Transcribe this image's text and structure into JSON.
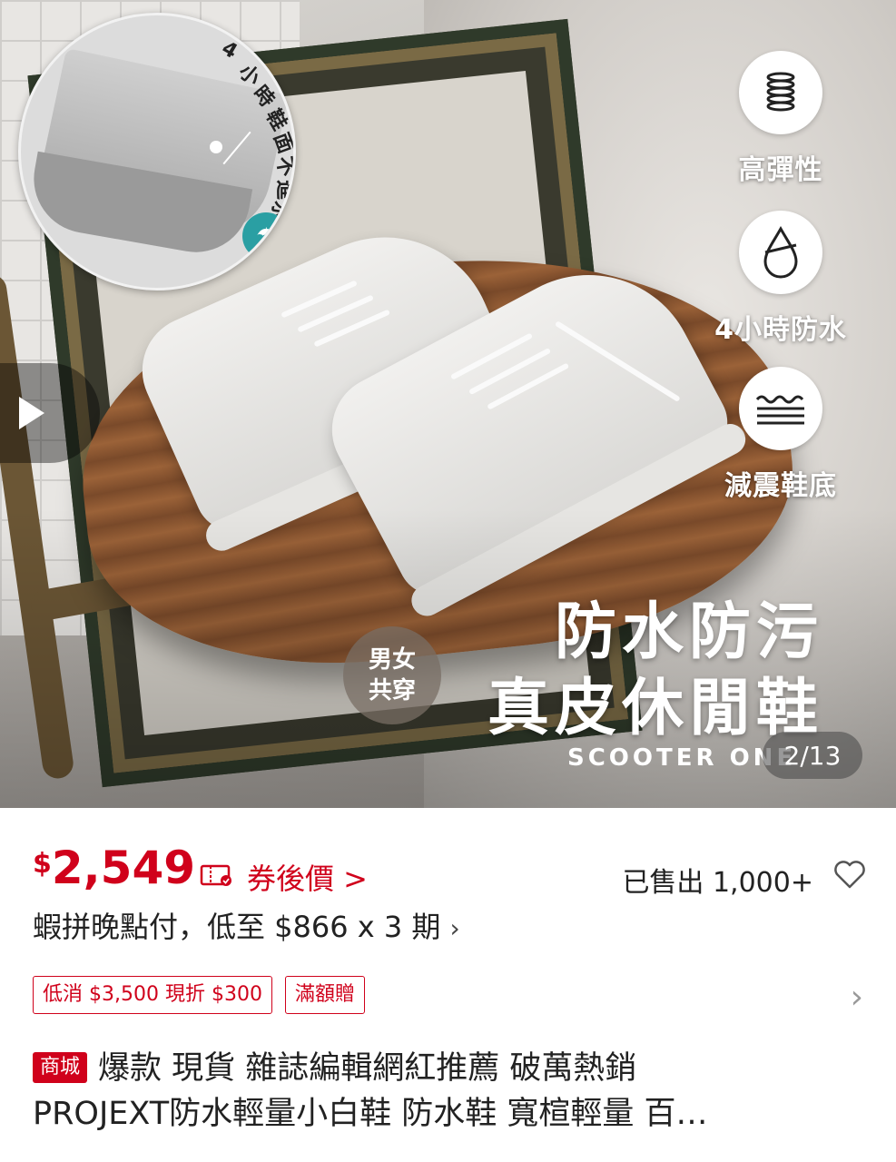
{
  "gallery": {
    "magnifier_text": "4小時鞋面不進水",
    "features": [
      {
        "label": "高彈性",
        "icon": "spring-icon"
      },
      {
        "label": "4小時防水",
        "icon": "water-drop-icon"
      },
      {
        "label": "減震鞋底",
        "icon": "cushion-sole-icon"
      }
    ],
    "unisex_line1": "男女",
    "unisex_line2": "共穿",
    "headline_line1": "防水防污",
    "headline_line2": "真皮休閒鞋",
    "brand": "SCOOTER ONE",
    "page_indicator": "2/13"
  },
  "product": {
    "price_symbol": "$",
    "price": "2,549",
    "coupon_label": "券後價 >",
    "sold": "已售出 1,000+",
    "installment": "蝦拼晚點付，低至 $866 x 3 期",
    "installment_chevron": "›",
    "promo_tags": [
      "低消 $3,500 現折 $300",
      "滿額贈"
    ],
    "promo_chevron": "›",
    "mall_badge": "商城",
    "title_line1": "爆款 現貨 雜誌編輯網紅推薦 破萬熱銷",
    "title_line2": "PROJEXT防水輕量小白鞋  防水鞋 寬楦輕量 百…"
  },
  "colors": {
    "accent": "#d0011b",
    "teal_badge": "#2a9fa3"
  }
}
